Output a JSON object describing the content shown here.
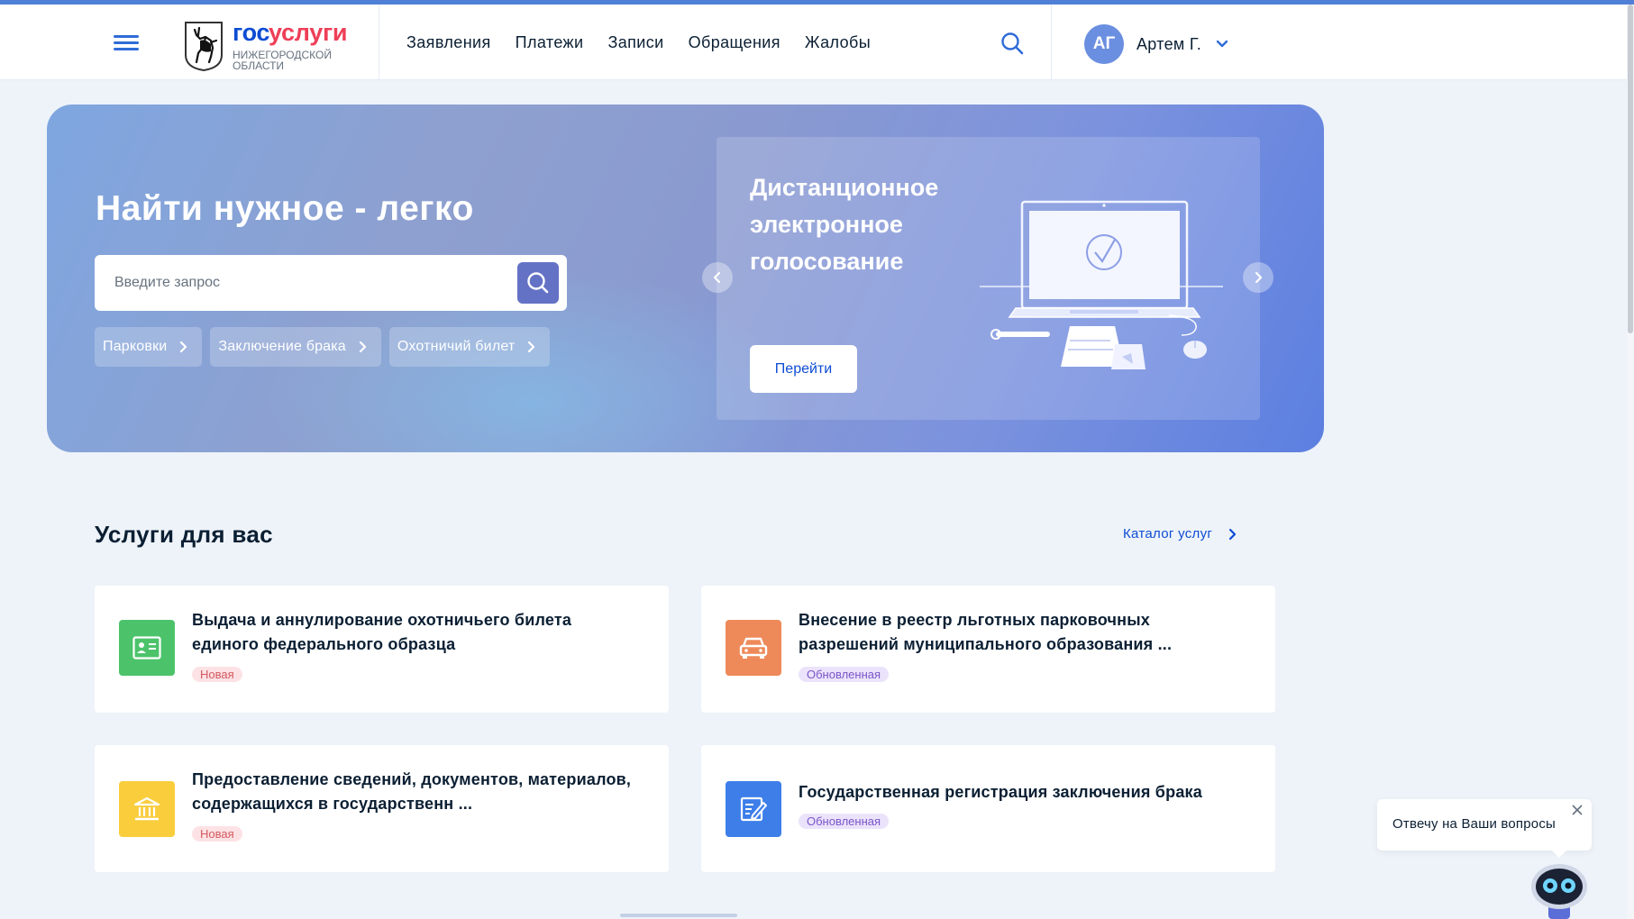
{
  "header": {
    "logo": {
      "brand_part1": "гос",
      "brand_part2": "услуги",
      "region": "Нижегородской области"
    },
    "nav": [
      "Заявления",
      "Платежи",
      "Записи",
      "Обращения",
      "Жалобы"
    ],
    "user": {
      "initials": "АГ",
      "name": "Артем Г."
    }
  },
  "banner": {
    "title": "Найти нужное - легко",
    "search_placeholder": "Введите запрос",
    "chips": [
      "Парковки",
      "Заключение брака",
      "Охотничий билет"
    ],
    "slide": {
      "title": "Дистанционное электронное голосование",
      "button": "Перейти"
    }
  },
  "services": {
    "title": "Услуги для вас",
    "catalog_link": "Каталог услуг",
    "cards": [
      {
        "title": "Выдача и аннулирование охотничьего билета единого федерального образца",
        "badge": "Новая",
        "icon": "id-card-icon",
        "color": "#4cc36b"
      },
      {
        "title": "Внесение в реестр льготных парковочных разрешений муниципального образования ...",
        "badge": "Обновленная",
        "icon": "car-icon",
        "color": "#ee8a5a"
      },
      {
        "title": "Предоставление сведений, документов, материалов, содержащихся в государственн ...",
        "badge": "Новая",
        "icon": "building-icon",
        "color": "#f9cd3c"
      },
      {
        "title": "Государственная регистрация заключения брака",
        "badge": "Обновленная",
        "icon": "document-edit-icon",
        "color": "#3d7ee9"
      }
    ]
  },
  "chat": {
    "text": "Отвечу на Ваши вопросы"
  },
  "colors": {
    "accent": "#0d4cd3",
    "brand_red": "#ee3f58",
    "search_button": "#6472c6"
  }
}
